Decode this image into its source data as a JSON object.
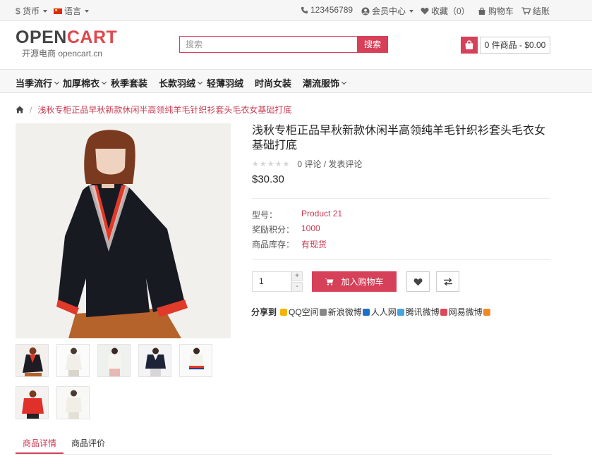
{
  "topbar": {
    "currency_label": "$ 货币",
    "language_label": "语言",
    "phone": "123456789",
    "account": "会员中心",
    "wishlist": "收藏（0）",
    "cart": "购物车",
    "checkout": "结账"
  },
  "logo": {
    "part1": "OPEN",
    "part2": "CART",
    "subtitle": "开源电商 opencart.cn"
  },
  "search": {
    "placeholder": "搜索",
    "button_label": "搜索"
  },
  "cart_summary": "0 件商品 - $0.00",
  "nav": [
    {
      "label": "当季流行",
      "has_dropdown": true
    },
    {
      "label": "加厚棉衣",
      "has_dropdown": true
    },
    {
      "label": "秋季套装",
      "has_dropdown": false
    },
    {
      "label": "长款羽绒",
      "has_dropdown": true
    },
    {
      "label": "轻薄羽绒",
      "has_dropdown": false
    },
    {
      "label": "时尚女装",
      "has_dropdown": false
    },
    {
      "label": "潮流服饰",
      "has_dropdown": true
    }
  ],
  "breadcrumb": {
    "current": "浅秋专柜正品早秋新款休闲半高领纯羊毛针织衫套头毛衣女基础打底"
  },
  "product": {
    "title": "浅秋专柜正品早秋新款休闲半高领纯羊毛针织衫套头毛衣女基础打底",
    "rating_text": "0 评论 / 发表评论",
    "rating_value": 0,
    "price": "$30.30",
    "specs": [
      {
        "label": "型号：",
        "value": "Product 21"
      },
      {
        "label": "奖励积分：",
        "value": "1000"
      },
      {
        "label": "商品库存：",
        "value": "有现货"
      }
    ],
    "quantity": "1",
    "add_to_cart_label": "加入购物车"
  },
  "share": {
    "label": "分享到",
    "items": [
      {
        "label": "QQ空间",
        "color": "#f5b400"
      },
      {
        "label": "新浪微博",
        "color": "#888888"
      },
      {
        "label": "人人网",
        "color": "#1e6fc8"
      },
      {
        "label": "腾讯微博",
        "color": "#4aa3df"
      },
      {
        "label": "网易微博",
        "color": "#e0475a"
      }
    ]
  },
  "tabs": [
    {
      "label": "商品详情",
      "active": true
    },
    {
      "label": "商品评价",
      "active": false
    }
  ],
  "colors": {
    "accent": "#d64058",
    "link": "#c93a50"
  }
}
